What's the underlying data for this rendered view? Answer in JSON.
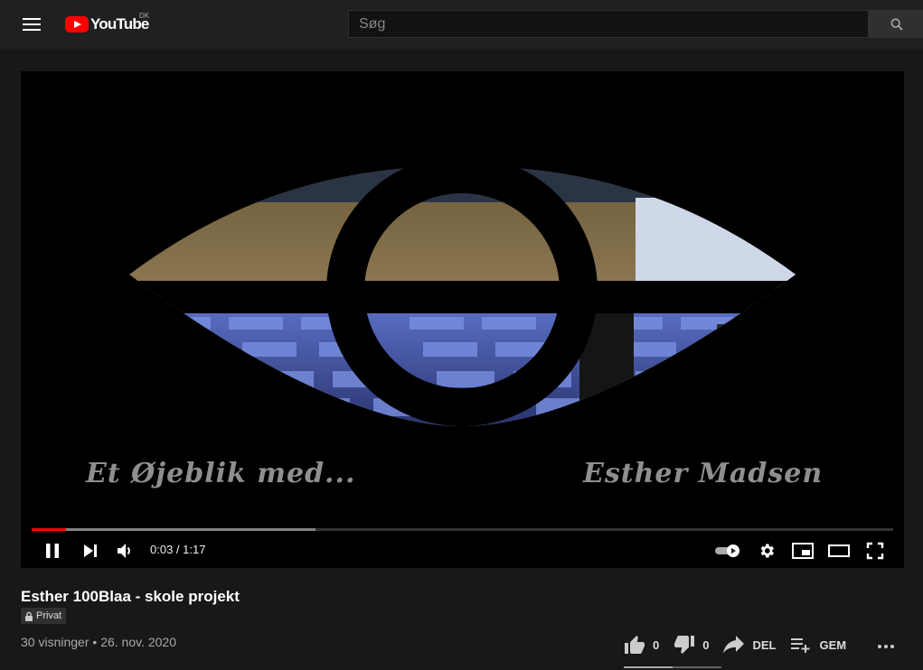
{
  "header": {
    "brand": "YouTube",
    "country_code": "DK",
    "search_placeholder": "Søg"
  },
  "player": {
    "overlay_left": "Et Øjeblik med...",
    "overlay_right": "Esther Madsen",
    "current_time": "0:03",
    "duration": "1:17",
    "progress_played_fraction": 0.04,
    "progress_buffered_fraction": 0.33,
    "autoplay": "on"
  },
  "video": {
    "title": "Esther 100Blaa - skole projekt",
    "privacy": "Privat",
    "views": "30 visninger",
    "date": "26. nov. 2020"
  },
  "actions": {
    "likes": "0",
    "dislikes": "0",
    "share": "DEL",
    "save": "GEM"
  },
  "colors": {
    "brand_red": "#ff0000",
    "background": "#181818",
    "header": "#202020"
  }
}
